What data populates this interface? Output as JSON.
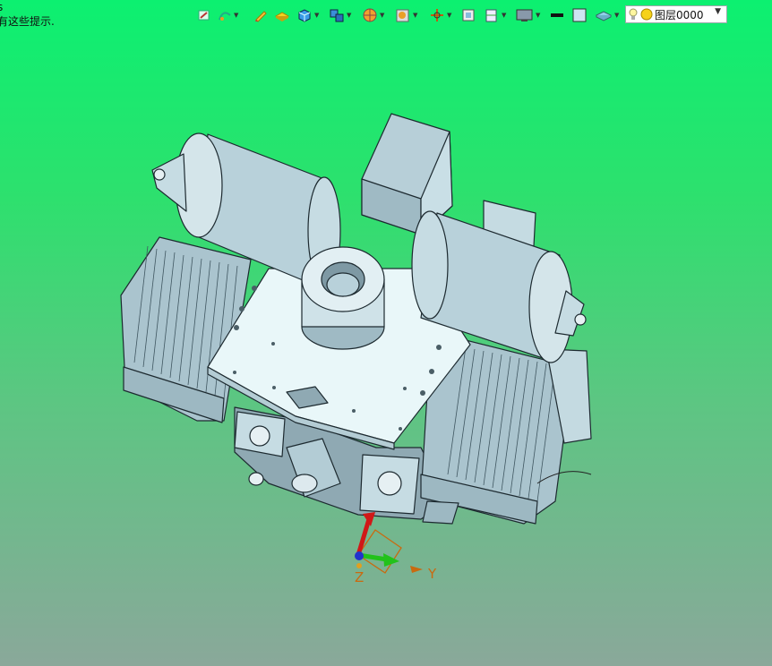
{
  "hint": {
    "line1": "s",
    "line2": "有这些提示."
  },
  "toolbar": {
    "items": [
      {
        "icon": "sketch-icon"
      },
      {
        "icon": "curve-icon"
      },
      {
        "icon": "pencil-icon"
      },
      {
        "icon": "surface-icon"
      },
      {
        "icon": "solid-box-icon"
      },
      {
        "icon": "assembly-icon"
      },
      {
        "icon": "sphere-icon"
      },
      {
        "icon": "render-icon"
      },
      {
        "icon": "move-icon"
      },
      {
        "icon": "view-fit-icon"
      },
      {
        "icon": "section-icon"
      },
      {
        "icon": "display-icon"
      },
      {
        "icon": "line-color-icon"
      },
      {
        "icon": "face-color-icon"
      },
      {
        "icon": "material-icon"
      }
    ],
    "layer": {
      "label": "图层0000",
      "bulb_icon": "bulb-icon",
      "status_icon": "layer-dot-icon"
    }
  },
  "triad": {
    "y_label": "Y",
    "z_label": "Z"
  },
  "colors": {
    "part": "#b9d4dc",
    "part_dark": "#5d7a86",
    "axis_z": "#d01818",
    "axis_y": "#22c21a",
    "axis_x": "#2233cc",
    "label": "#c96a10"
  }
}
